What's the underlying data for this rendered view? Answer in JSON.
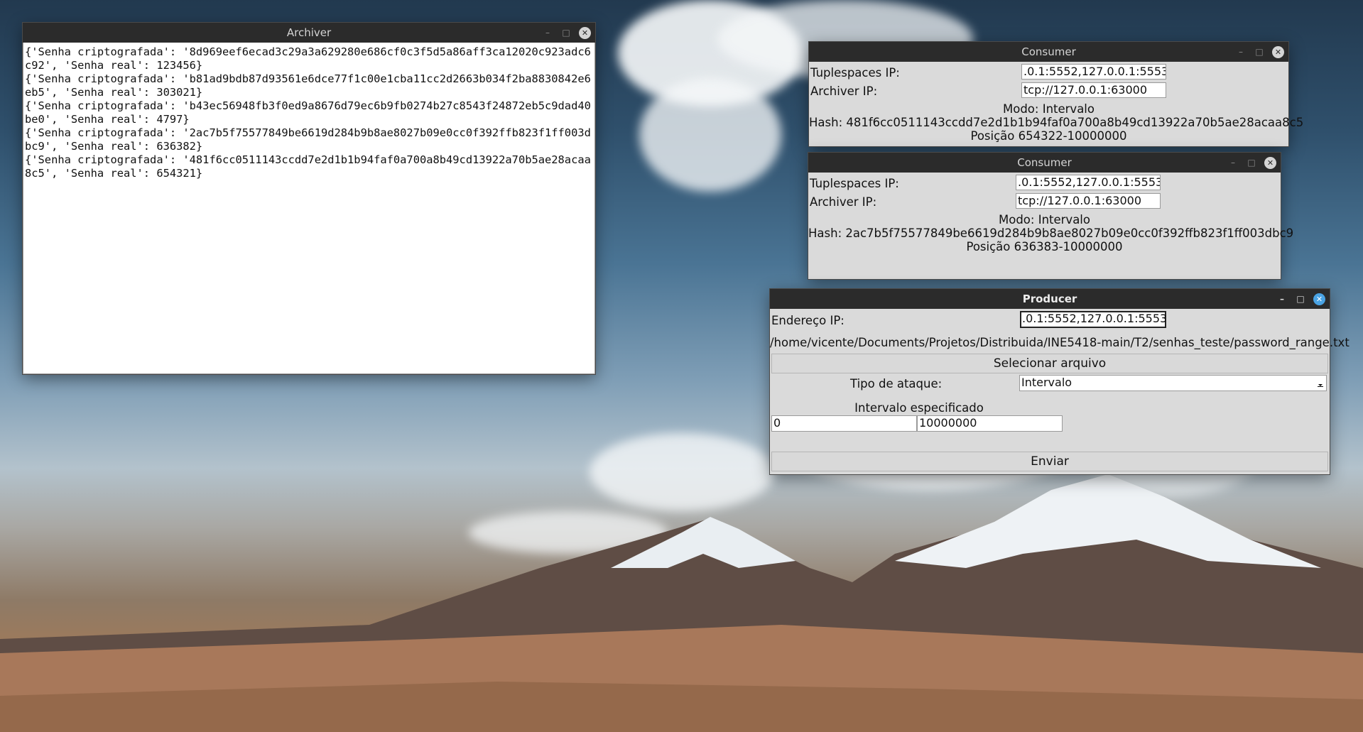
{
  "archiver": {
    "title": "Archiver",
    "log": "{'Senha criptografada': '8d969eef6ecad3c29a3a629280e686cf0c3f5d5a86aff3ca12020c923adc6c92', 'Senha real': 123456}\n{'Senha criptografada': 'b81ad9bdb87d93561e6dce77f1c00e1cba11cc2d2663b034f2ba8830842e6eb5', 'Senha real': 303021}\n{'Senha criptografada': 'b43ec56948fb3f0ed9a8676d79ec6b9fb0274b27c8543f24872eb5c9dad40be0', 'Senha real': 4797}\n{'Senha criptografada': '2ac7b5f75577849be6619d284b9b8ae8027b09e0cc0f392ffb823f1ff003dbc9', 'Senha real': 636382}\n{'Senha criptografada': '481f6cc0511143ccdd7e2d1b1b94faf0a700a8b49cd13922a70b5ae28acaa8c5', 'Senha real': 654321}"
  },
  "consumer1": {
    "title": "Consumer",
    "tuplespaces_label": "Tuplespaces IP:",
    "tuplespaces_value": ".0.1:5552,127.0.0.1:5553",
    "archiver_label": "Archiver IP:",
    "archiver_value": "tcp://127.0.0.1:63000",
    "modo": "Modo: Intervalo",
    "hash": "Hash: 481f6cc0511143ccdd7e2d1b1b94faf0a700a8b49cd13922a70b5ae28acaa8c5",
    "posicao": "Posição 654322-10000000"
  },
  "consumer2": {
    "title": "Consumer",
    "tuplespaces_label": "Tuplespaces IP:",
    "tuplespaces_value": ".0.1:5552,127.0.0.1:5553",
    "archiver_label": "Archiver IP:",
    "archiver_value": "tcp://127.0.0.1:63000",
    "modo": "Modo: Intervalo",
    "hash": "Hash: 2ac7b5f75577849be6619d284b9b8ae8027b09e0cc0f392ffb823f1ff003dbc9",
    "posicao": "Posição 636383-10000000"
  },
  "producer": {
    "title": "Producer",
    "endereco_label": "Endereço IP:",
    "endereco_value": ".0.1:5552,127.0.0.1:5553",
    "file_path": "/home/vicente/Documents/Projetos/Distribuida/INE5418-main/T2/senhas_teste/password_range.txt",
    "select_file_label": "Selecionar arquivo",
    "attack_type_label": "Tipo de ataque:",
    "attack_type_value": "Intervalo",
    "interval_label": "Intervalo especificado",
    "interval_start": "0",
    "interval_end": "10000000",
    "send_label": "Enviar"
  },
  "window_controls": {
    "minimize": "–",
    "maximize": "□",
    "close": "✕"
  }
}
